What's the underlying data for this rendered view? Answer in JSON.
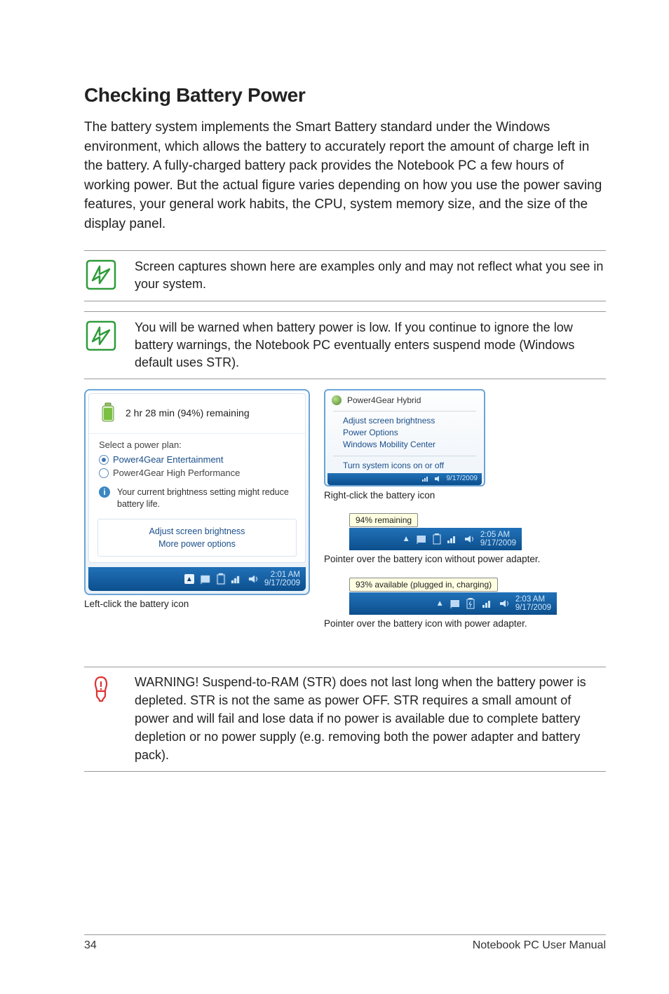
{
  "heading": "Checking Battery Power",
  "intro": "The battery system implements the Smart Battery standard under the Windows environment, which allows the battery to accurately report the amount of charge left in the battery. A fully-charged battery pack provides the Notebook PC a few hours of working power. But the actual figure varies depending on how you use the power saving features, your general work habits, the CPU, system memory size, and the size of the display panel.",
  "note1": "Screen captures shown here are examples only and may not reflect what you see in your system.",
  "note2": "You will be warned when battery power is low. If you continue to ignore the low battery warnings, the Notebook PC eventually enters suspend mode (Windows default uses STR).",
  "warning": "WARNING!  Suspend-to-RAM (STR) does not last long when the battery power is depleted. STR is not the same as power OFF. STR requires a small amount of power and will fail and lose data if no power is available due to complete battery depletion or no power supply (e.g. removing both the power adapter and battery pack).",
  "left_popup": {
    "remaining": "2 hr 28 min (94%) remaining",
    "plan_title": "Select a power plan:",
    "plan_selected": "Power4Gear Entertainment",
    "plan_other": "Power4Gear High Performance",
    "info": "Your current brightness setting might reduce battery life.",
    "link1": "Adjust screen brightness",
    "link2": "More power options",
    "time": "2:01 AM",
    "date": "9/17/2009"
  },
  "caption_left": "Left-click the battery icon",
  "ctx": {
    "title": "Power4Gear Hybrid",
    "items": [
      "Adjust screen brightness",
      "Power Options",
      "Windows Mobility Center"
    ],
    "sysicons": "Turn system icons on or off",
    "date": "9/17/2009"
  },
  "caption_right1": "Right-click the battery icon",
  "tooltip1": "94% remaining",
  "tray_a_time": "2:05 AM",
  "tray_a_date": "9/17/2009",
  "caption_right2": "Pointer over the battery icon without power adapter.",
  "tooltip2": "93% available (plugged in, charging)",
  "tray_b_time": "2:03 AM",
  "tray_b_date": "9/17/2009",
  "caption_right3": "Pointer over the battery icon with power adapter.",
  "footer_page": "34",
  "footer_title": "Notebook PC User Manual"
}
